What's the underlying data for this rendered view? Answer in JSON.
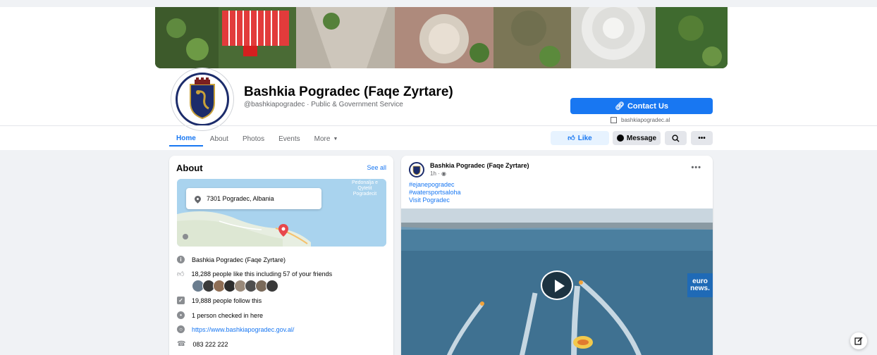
{
  "page": {
    "name": "Bashkia Pogradec (Faqe Zyrtare)",
    "handle_category": "@bashkiapogradec · Public & Government Service",
    "contact_label": "Contact Us",
    "website_short": "bashkiapogradec.al"
  },
  "tabs": {
    "home": "Home",
    "about": "About",
    "photos": "Photos",
    "events": "Events",
    "more": "More"
  },
  "actions": {
    "like": "Like",
    "message": "Message"
  },
  "about": {
    "title": "About",
    "see_all": "See all",
    "address": "7301 Pogradec, Albania",
    "map_label": "Pedonalja e\nQytetit\nPogradecit",
    "page_name": "Bashkia Pogradec (Faqe Zyrtare)",
    "likes": "18,288 people like this including 57 of your friends",
    "follows": "19,888 people follow this",
    "checkins": "1 person checked in here",
    "website": "https://www.bashkiapogradec.gov.al/",
    "phone": "083 222 222"
  },
  "post": {
    "author": "Bashkia Pogradec (Faqe Zyrtare)",
    "time": "1h",
    "tags": [
      "#ejanepogradec",
      "#watersportsaloha",
      "Visit Pogradec"
    ],
    "video_watermark_top": "euro",
    "video_watermark_bottom": "news."
  },
  "colors": {
    "accent": "#1877f2",
    "background": "#f0f2f5",
    "text_secondary": "#65676b"
  }
}
